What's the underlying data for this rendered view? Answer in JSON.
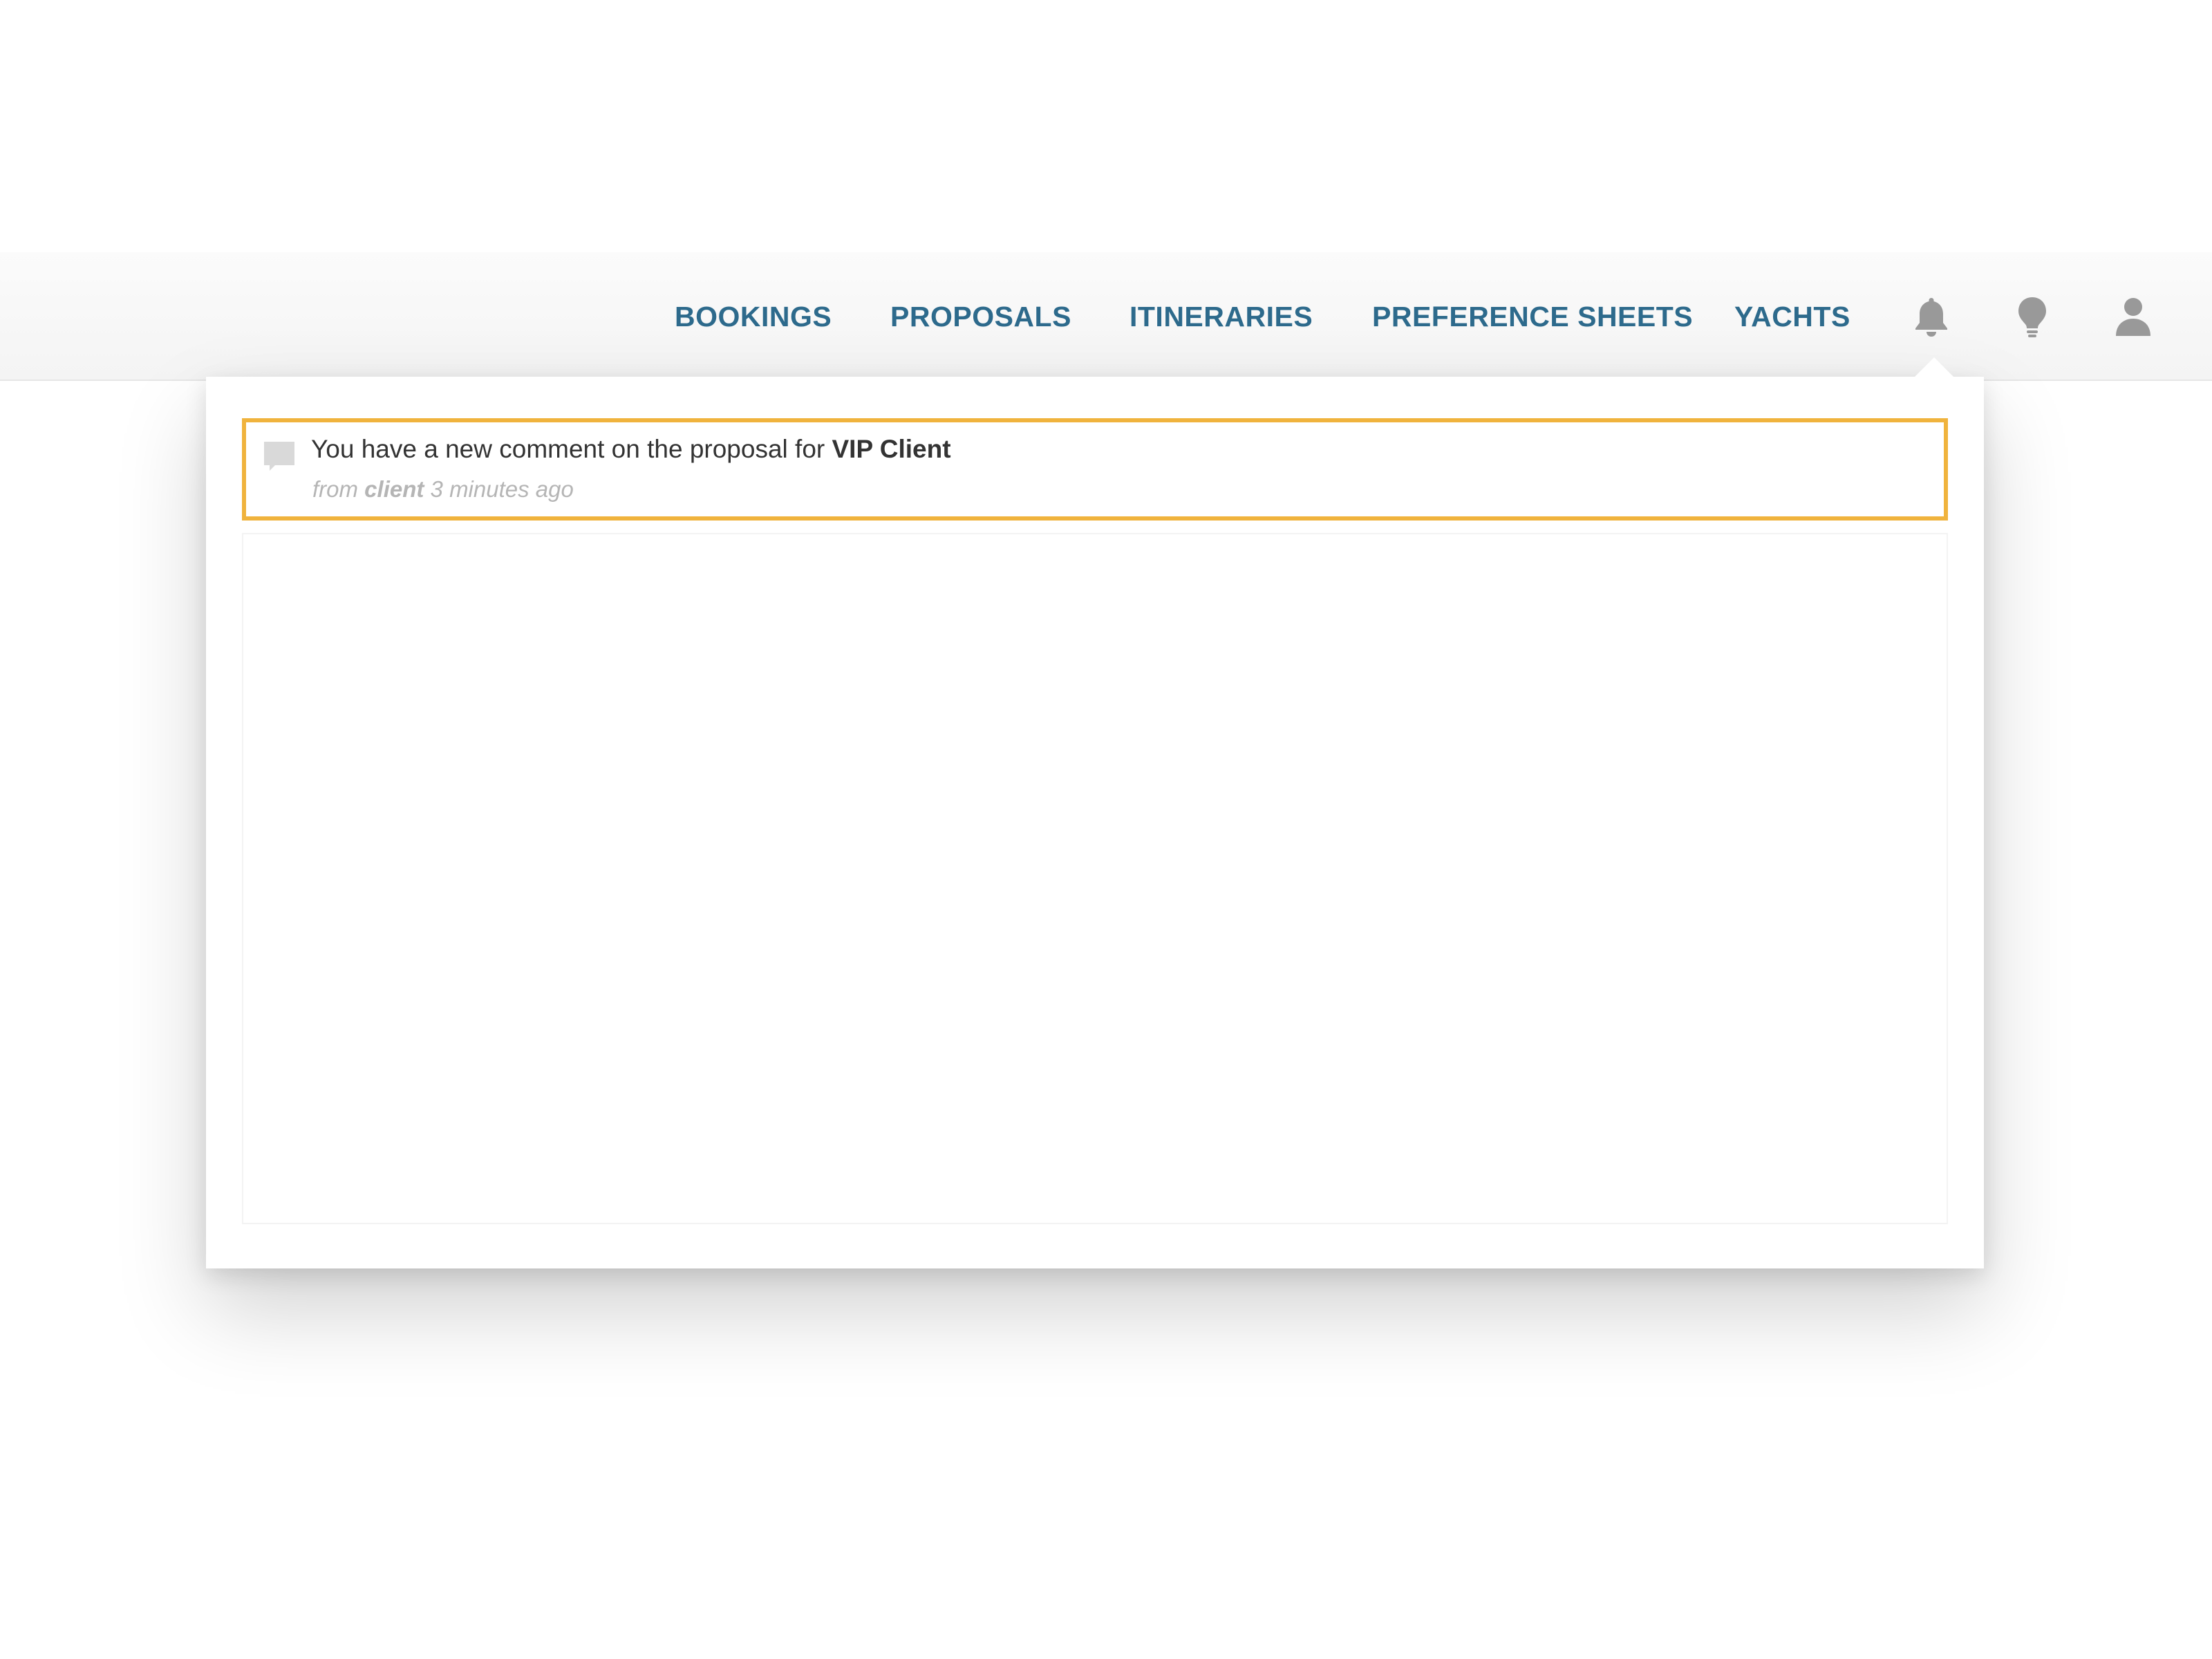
{
  "nav": {
    "items": [
      {
        "label": "BOOKINGS"
      },
      {
        "label": "PROPOSALS"
      },
      {
        "label": "ITINERARIES"
      },
      {
        "label": "PREFERENCE SHEETS"
      },
      {
        "label": "YACHTS"
      }
    ],
    "icons": [
      "bell-icon",
      "lightbulb-icon",
      "user-icon"
    ],
    "link_color": "#2d6a8c",
    "icon_color": "#999999"
  },
  "notifications": {
    "items": [
      {
        "icon": "comment-icon",
        "text_prefix": "You have a new comment on the proposal for",
        "subject": "VIP Client",
        "meta_from": "from",
        "meta_author": "client",
        "meta_time": "3 minutes ago",
        "highlight_color": "#f0b33d"
      }
    ]
  }
}
